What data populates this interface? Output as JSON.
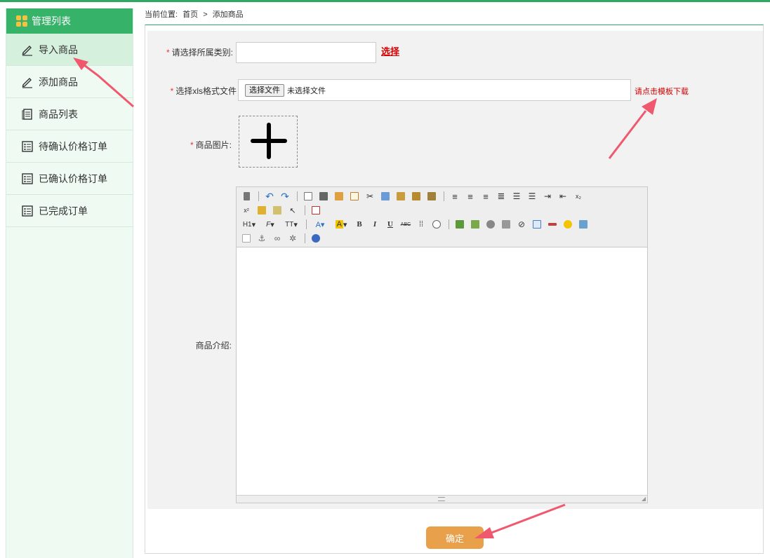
{
  "sidebar": {
    "title": "管理列表",
    "items": [
      {
        "label": "导入商品",
        "icon": "pencil-icon"
      },
      {
        "label": "添加商品",
        "icon": "pencil-icon"
      },
      {
        "label": "商品列表",
        "icon": "document-list-icon"
      },
      {
        "label": "待确认价格订单",
        "icon": "list-icon"
      },
      {
        "label": "已确认价格订单",
        "icon": "list-icon"
      },
      {
        "label": "已完成订单",
        "icon": "list-icon"
      }
    ]
  },
  "breadcrumb": {
    "prefix": "当前位置:",
    "home": "首页",
    "separator": ">",
    "current": "添加商品"
  },
  "form": {
    "required_mark": "*",
    "category_label": "请选择所属类别:",
    "category_value": "",
    "choose_link": "选择",
    "file_label": "选择xls格式文件",
    "file_button": "选择文件",
    "file_status": "未选择文件",
    "template_link": "请点击模板下载",
    "image_label": "商品图片:",
    "intro_label": "商品介绍:",
    "submit_label": "确定"
  },
  "editor": {
    "toolbar_text": {
      "h1": "H1",
      "font": "F",
      "size": "TT",
      "bold": "B",
      "italic": "I",
      "underline": "U",
      "strike": "ABC"
    }
  },
  "colors": {
    "brand_green": "#36b368",
    "required_red": "#e33333",
    "link_red": "#d70000",
    "submit_orange": "#e8a04a",
    "arrow_pink": "#f0586e"
  }
}
